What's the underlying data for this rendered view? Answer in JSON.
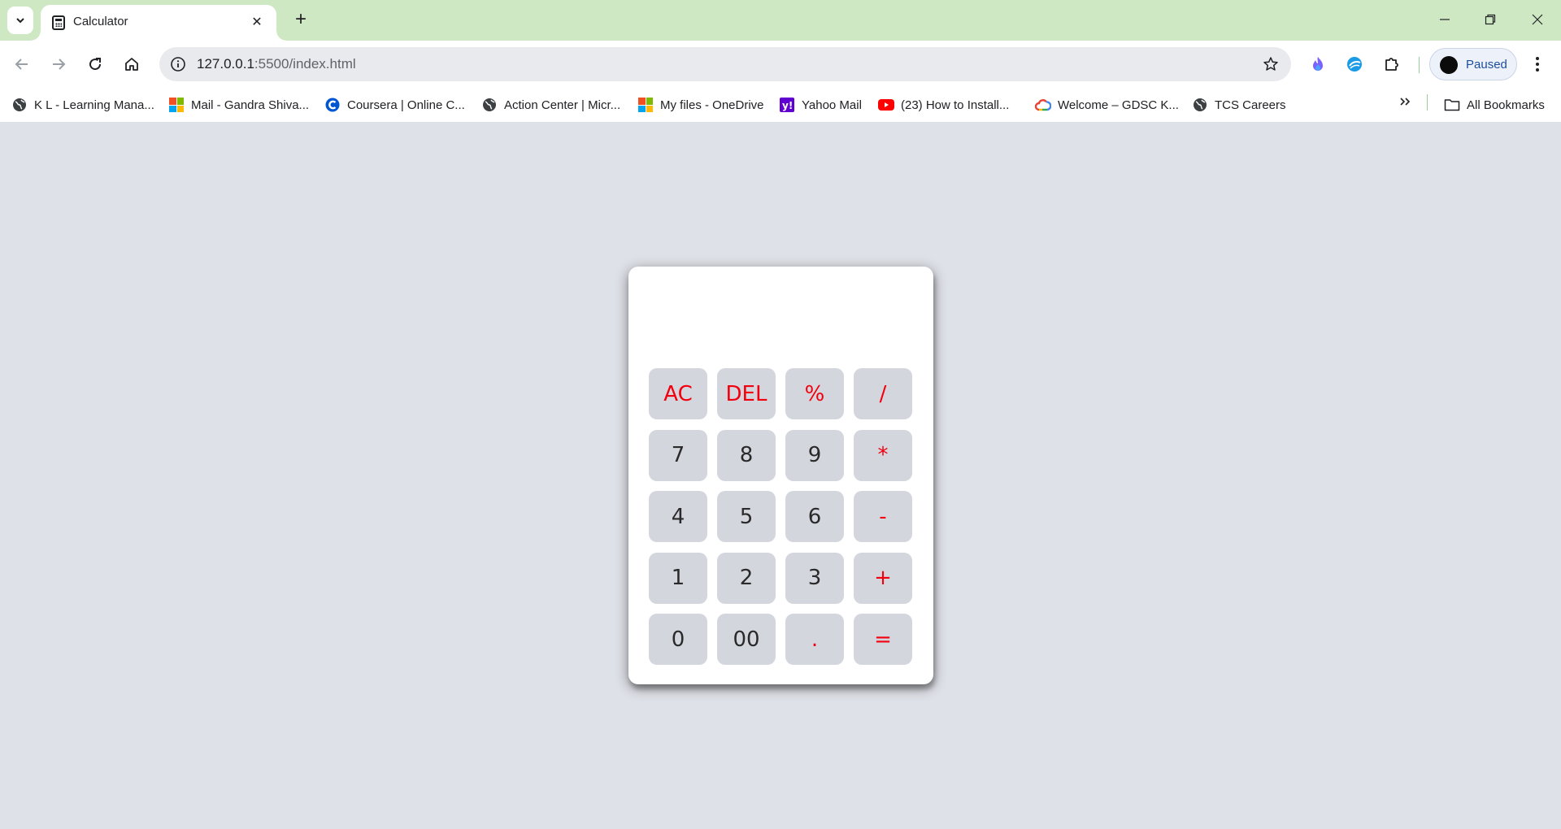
{
  "browser": {
    "tab": {
      "title": "Calculator"
    },
    "address": {
      "host": "127.0.0.1",
      "path": ":5500/index.html"
    },
    "profile": {
      "label": "Paused"
    },
    "bookmarks": [
      {
        "label": "K L - Learning Mana...",
        "icon": "globe-icon"
      },
      {
        "label": "Mail - Gandra Shiva...",
        "icon": "microsoft-icon"
      },
      {
        "label": "Coursera | Online C...",
        "icon": "coursera-icon"
      },
      {
        "label": "Action Center | Micr...",
        "icon": "globe-icon"
      },
      {
        "label": "My files - OneDrive",
        "icon": "microsoft-icon"
      },
      {
        "label": "Yahoo Mail",
        "icon": "yahoo-icon"
      },
      {
        "label": "(23) How to Install...",
        "icon": "youtube-icon"
      },
      {
        "label": "Welcome – GDSC K...",
        "icon": "google-cloud-icon"
      },
      {
        "label": "TCS Careers",
        "icon": "globe-icon"
      }
    ],
    "all_bookmarks_label": "All Bookmarks"
  },
  "calculator": {
    "display_value": "",
    "keys": [
      {
        "label": "AC",
        "type": "operator",
        "name": "all-clear"
      },
      {
        "label": "DEL",
        "type": "operator",
        "name": "delete"
      },
      {
        "label": "%",
        "type": "operator",
        "name": "percent"
      },
      {
        "label": "/",
        "type": "operator",
        "name": "divide"
      },
      {
        "label": "7",
        "type": "digit",
        "name": "7"
      },
      {
        "label": "8",
        "type": "digit",
        "name": "8"
      },
      {
        "label": "9",
        "type": "digit",
        "name": "9"
      },
      {
        "label": "*",
        "type": "operator",
        "name": "multiply"
      },
      {
        "label": "4",
        "type": "digit",
        "name": "4"
      },
      {
        "label": "5",
        "type": "digit",
        "name": "5"
      },
      {
        "label": "6",
        "type": "digit",
        "name": "6"
      },
      {
        "label": "-",
        "type": "operator",
        "name": "subtract"
      },
      {
        "label": "1",
        "type": "digit",
        "name": "1"
      },
      {
        "label": "2",
        "type": "digit",
        "name": "2"
      },
      {
        "label": "3",
        "type": "digit",
        "name": "3"
      },
      {
        "label": "+",
        "type": "operator",
        "name": "add"
      },
      {
        "label": "0",
        "type": "digit",
        "name": "0"
      },
      {
        "label": "00",
        "type": "digit",
        "name": "double-zero"
      },
      {
        "label": ".",
        "type": "operator",
        "name": "decimal"
      },
      {
        "label": "=",
        "type": "operator",
        "name": "equals"
      }
    ]
  },
  "colors": {
    "tabstrip": "#cfe8c4",
    "page_background": "#dfe1e8",
    "key_background": "#d4d6de",
    "operator_text": "#f2000e",
    "digit_text": "#2a2a2a"
  }
}
